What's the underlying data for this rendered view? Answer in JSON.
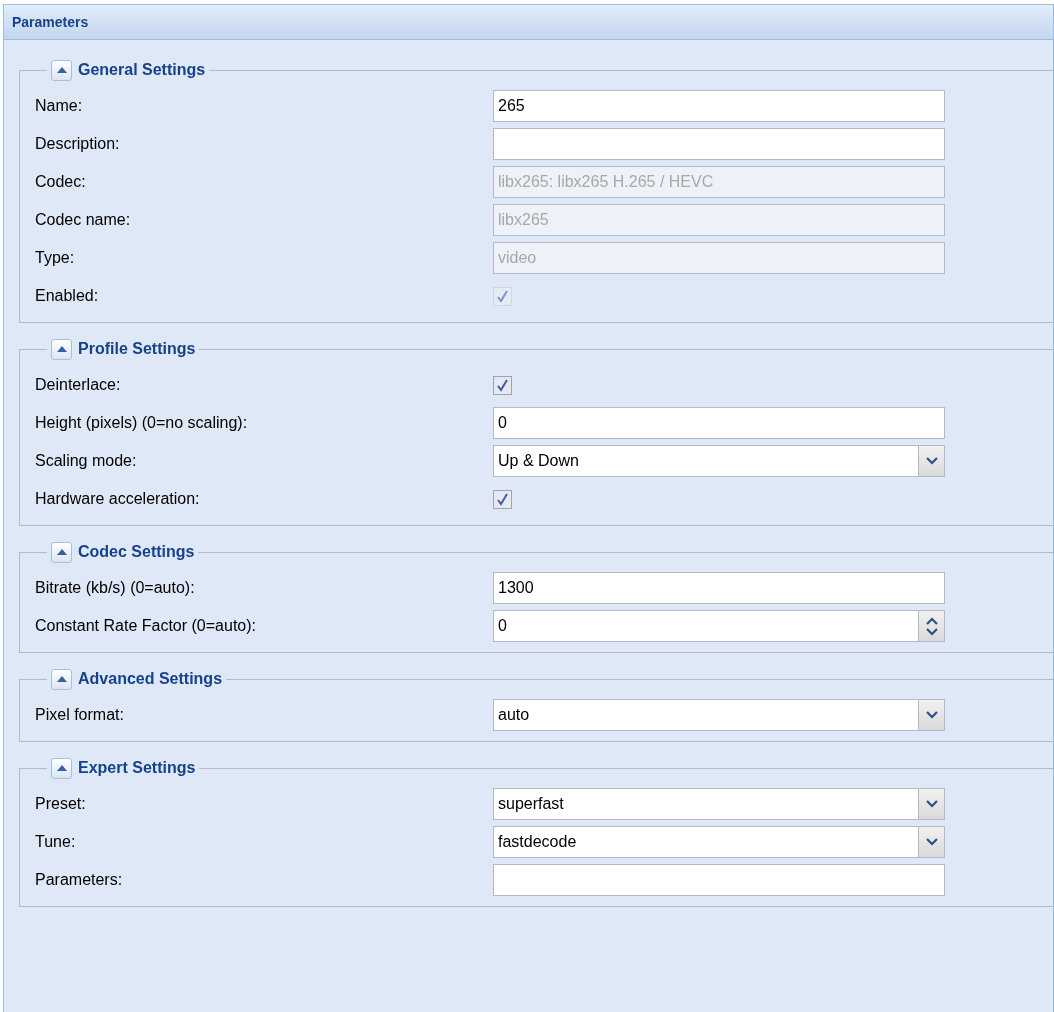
{
  "panel": {
    "title": "Parameters"
  },
  "sections": [
    {
      "title": "General Settings",
      "expanded": true,
      "fields": [
        {
          "label": "Name:",
          "kind": "text",
          "value": "265",
          "disabled": false
        },
        {
          "label": "Description:",
          "kind": "text",
          "disabled": false
        },
        {
          "label": "Codec:",
          "kind": "text",
          "value": "libx265: libx265 H.265 / HEVC",
          "disabled": true
        },
        {
          "label": "Codec name:",
          "kind": "text",
          "value": "libx265",
          "disabled": true
        },
        {
          "label": "Type:",
          "kind": "text",
          "value": "video",
          "disabled": true
        },
        {
          "label": "Enabled:",
          "kind": "checkbox",
          "checked": true,
          "disabled": true
        }
      ]
    },
    {
      "title": "Profile Settings",
      "expanded": true,
      "fields": [
        {
          "label": "Deinterlace:",
          "kind": "checkbox",
          "checked": true,
          "disabled": false
        },
        {
          "label": "Height (pixels) (0=no scaling):",
          "kind": "text",
          "value": "0",
          "disabled": false
        },
        {
          "label": "Scaling mode:",
          "kind": "select",
          "value": "Up & Down",
          "disabled": false
        },
        {
          "label": "Hardware acceleration:",
          "kind": "checkbox",
          "checked": true,
          "disabled": false
        }
      ]
    },
    {
      "title": "Codec Settings",
      "expanded": true,
      "fields": [
        {
          "label": "Bitrate (kb/s) (0=auto):",
          "kind": "text",
          "value": "1300",
          "disabled": false
        },
        {
          "label": "Constant Rate Factor (0=auto):",
          "kind": "spinner",
          "value": "0",
          "disabled": false
        }
      ]
    },
    {
      "title": "Advanced Settings",
      "expanded": true,
      "fields": [
        {
          "label": "Pixel format:",
          "kind": "select",
          "value": "auto",
          "disabled": false
        }
      ]
    },
    {
      "title": "Expert Settings",
      "expanded": true,
      "fields": [
        {
          "label": "Preset:",
          "kind": "select",
          "value": "superfast",
          "disabled": false
        },
        {
          "label": "Tune:",
          "kind": "select",
          "value": "fastdecode",
          "disabled": false
        },
        {
          "label": "Parameters:",
          "kind": "text",
          "disabled": false
        }
      ]
    }
  ]
}
